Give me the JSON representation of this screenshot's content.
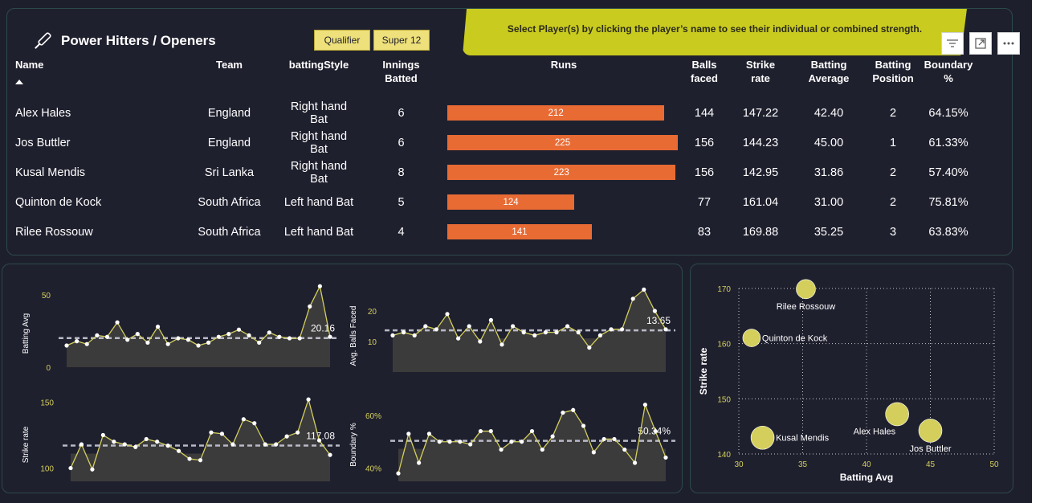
{
  "header": {
    "title": "Power Hitters / Openers",
    "chips": [
      "Qualifier",
      "Super 12"
    ],
    "banner": "Select Player(s) by clicking the player’s name to see their individual or combined strength."
  },
  "table": {
    "columns": [
      "Name",
      "Team",
      "battingStyle",
      "Innings Batted",
      "Runs",
      "Balls faced",
      "Strike rate",
      "Batting Average",
      "Batting Position",
      "Boundary %"
    ],
    "max_runs": 225,
    "rows": [
      {
        "name": "Alex Hales",
        "team": "England",
        "style": "Right hand Bat",
        "innings": "6",
        "runs": 212,
        "runs_label": "212",
        "balls": "144",
        "sr": "147.22",
        "avg": "42.40",
        "pos": "2",
        "boundary": "64.15%"
      },
      {
        "name": "Jos Buttler",
        "team": "England",
        "style": "Right hand Bat",
        "innings": "6",
        "runs": 225,
        "runs_label": "225",
        "balls": "156",
        "sr": "144.23",
        "avg": "45.00",
        "pos": "1",
        "boundary": "61.33%"
      },
      {
        "name": "Kusal Mendis",
        "team": "Sri Lanka",
        "style": "Right hand Bat",
        "innings": "8",
        "runs": 223,
        "runs_label": "223",
        "balls": "156",
        "sr": "142.95",
        "avg": "31.86",
        "pos": "2",
        "boundary": "57.40%"
      },
      {
        "name": "Quinton de Kock",
        "team": "South Africa",
        "style": "Left hand Bat",
        "innings": "5",
        "runs": 124,
        "runs_label": "124",
        "balls": "77",
        "sr": "161.04",
        "avg": "31.00",
        "pos": "2",
        "boundary": "75.81%"
      },
      {
        "name": "Rilee Rossouw",
        "team": "South Africa",
        "style": "Left hand Bat",
        "innings": "4",
        "runs": 141,
        "runs_label": "141",
        "balls": "83",
        "sr": "169.88",
        "avg": "35.25",
        "pos": "3",
        "boundary": "63.83%"
      }
    ]
  },
  "colors": {
    "accent": "#e86b34",
    "yellow": "#d4cf5c",
    "banner": "#c9cb1f",
    "panel": "#1f202e"
  },
  "chart_data": [
    {
      "type": "area",
      "title": "",
      "ylabel": "Batting Avg",
      "ylim": [
        0,
        60
      ],
      "yticks": [
        "50",
        "0"
      ],
      "ytick_values": [
        50,
        0
      ],
      "reference_line": 20.16,
      "reference_label": "20.16",
      "values": [
        15,
        18,
        16,
        22,
        21,
        31,
        19,
        23,
        17,
        28,
        16,
        20,
        19,
        15,
        17,
        21,
        23,
        26,
        22,
        17,
        24,
        21,
        20,
        20,
        42,
        56,
        21
      ]
    },
    {
      "type": "area",
      "title": "",
      "ylabel": "Avg. Balls Faced",
      "ylim": [
        0,
        30
      ],
      "yticks": [
        "20",
        "10"
      ],
      "ytick_values": [
        20,
        10
      ],
      "reference_line": 13.65,
      "reference_label": "13.65",
      "values": [
        12,
        13,
        12,
        15,
        14,
        19,
        11,
        15,
        10,
        17,
        9,
        15,
        13,
        12,
        13,
        13,
        15,
        13,
        8,
        12,
        14,
        14,
        24,
        27,
        20,
        14
      ]
    },
    {
      "type": "area",
      "title": "",
      "ylabel": "Strike rate",
      "ylim": [
        90,
        160
      ],
      "yticks": [
        "150",
        "100"
      ],
      "ytick_values": [
        150,
        100
      ],
      "reference_line": 117.08,
      "reference_label": "117.08",
      "values": [
        100,
        118,
        99,
        125,
        120,
        118,
        116,
        122,
        120,
        117,
        113,
        107,
        106,
        127,
        126,
        118,
        137,
        134,
        118,
        118,
        124,
        127,
        152,
        121,
        110
      ]
    },
    {
      "type": "area",
      "title": "",
      "ylabel": "Boundary %",
      "ylim": [
        0.35,
        0.7
      ],
      "yticks": [
        "60%",
        "40%"
      ],
      "ytick_values": [
        0.6,
        0.4
      ],
      "reference_line": 0.5034,
      "reference_label": "50.34%",
      "values": [
        0.38,
        0.53,
        0.42,
        0.53,
        0.5,
        0.5,
        0.5,
        0.49,
        0.54,
        0.54,
        0.47,
        0.5,
        0.5,
        0.54,
        0.47,
        0.52,
        0.61,
        0.62,
        0.56,
        0.46,
        0.51,
        0.51,
        0.47,
        0.42,
        0.64,
        0.54,
        0.44
      ]
    },
    {
      "type": "scatter",
      "title": "",
      "xlabel": "Batting Avg",
      "ylabel": "Strike rate",
      "xlim": [
        30,
        50
      ],
      "ylim": [
        140,
        170
      ],
      "xticks": [
        30,
        35,
        40,
        45,
        50
      ],
      "yticks": [
        140,
        150,
        160,
        170
      ],
      "grid": true,
      "points": [
        {
          "label": "Rilee Rossouw",
          "x": 35.25,
          "y": 169.88,
          "label_pos": "below"
        },
        {
          "label": "Quinton de Kock",
          "x": 31.0,
          "y": 161.04,
          "label_pos": "right"
        },
        {
          "label": "Kusal Mendis",
          "x": 31.86,
          "y": 142.95,
          "label_pos": "right"
        },
        {
          "label": "Alex Hales",
          "x": 42.4,
          "y": 147.22,
          "label_pos": "left-below"
        },
        {
          "label": "Jos Buttler",
          "x": 45.0,
          "y": 144.23,
          "label_pos": "below"
        }
      ]
    }
  ]
}
